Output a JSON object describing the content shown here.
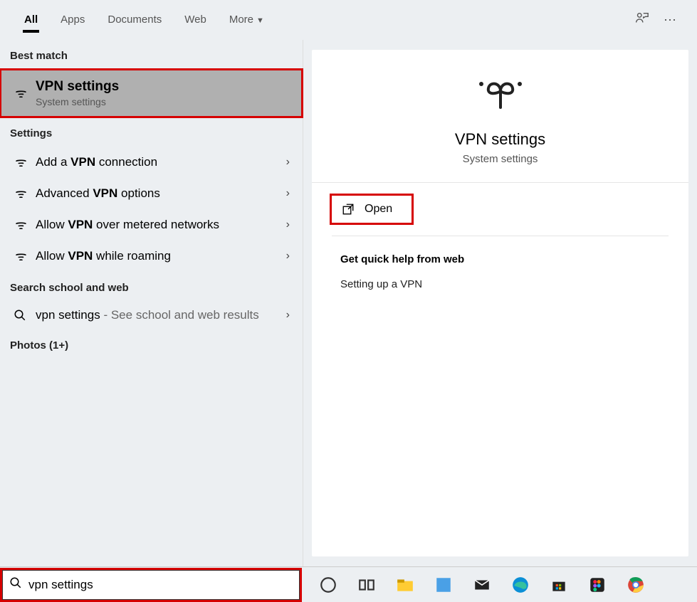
{
  "tabs": {
    "all": "All",
    "apps": "Apps",
    "documents": "Documents",
    "web": "Web",
    "more": "More"
  },
  "sections": {
    "best_match": "Best match",
    "settings": "Settings",
    "search_school_web": "Search school and web",
    "photos": "Photos (1+)"
  },
  "best_match": {
    "title": "VPN settings",
    "subtitle": "System settings"
  },
  "settings_list": [
    {
      "prefix": "Add a ",
      "bold": "VPN",
      "suffix": " connection"
    },
    {
      "prefix": "Advanced ",
      "bold": "VPN",
      "suffix": " options"
    },
    {
      "prefix": "Allow ",
      "bold": "VPN",
      "suffix": " over metered networks"
    },
    {
      "prefix": "Allow ",
      "bold": "VPN",
      "suffix": " while roaming"
    }
  ],
  "web_search": {
    "query": "vpn settings",
    "suffix": " - See school and web results"
  },
  "detail": {
    "title": "VPN settings",
    "subtitle": "System settings",
    "open": "Open",
    "quick_help_title": "Get quick help from web",
    "quick_help_link": "Setting up a VPN"
  },
  "search_input": {
    "value": "vpn settings"
  },
  "taskbar_icons": [
    "cortana",
    "task-view",
    "file-explorer",
    "word",
    "mail",
    "edge",
    "store",
    "figma",
    "chrome"
  ]
}
